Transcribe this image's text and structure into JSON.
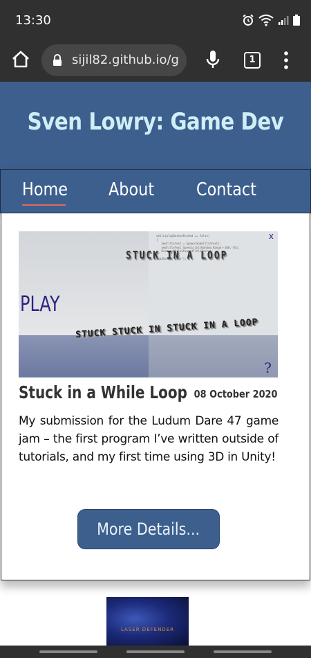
{
  "status_bar": {
    "time": "13:30",
    "icons": [
      "alarm-icon",
      "wifi-icon",
      "signal-icon",
      "battery-icon"
    ]
  },
  "browser": {
    "url": "sijil82.github.io/g",
    "tab_count": "1",
    "icons": [
      "home-icon",
      "lock-icon",
      "mic-icon",
      "tabs-icon",
      "menu-icon"
    ]
  },
  "site": {
    "title": "Sven Lowry: Game Dev",
    "nav": {
      "home": "Home",
      "about": "About",
      "contact": "Contact",
      "active": "Home"
    }
  },
  "post": {
    "title": "Stuck in a While Loop",
    "date": "08 October 2020",
    "description": "My submission for the Ludum Dare 47 game jam – the first program I’ve written outside of tutorials, and my first time using 3D in Unity!",
    "button_label": "More Details...",
    "thumbnail": {
      "play": "PLAY",
      "close": "x",
      "help": "?",
      "stuck_top": "STUCK IN A LOOP",
      "stuck_low": "STUCK STUCK IN STUCK IN A LOOP"
    }
  },
  "next_post": {
    "thumbnail_label": "LASER DEFENDER"
  },
  "colors": {
    "browser_bg": "#303030",
    "site_blue": "#3d5f8e",
    "title_text": "#cfeef5",
    "nav_underline": "#e26a5a"
  }
}
